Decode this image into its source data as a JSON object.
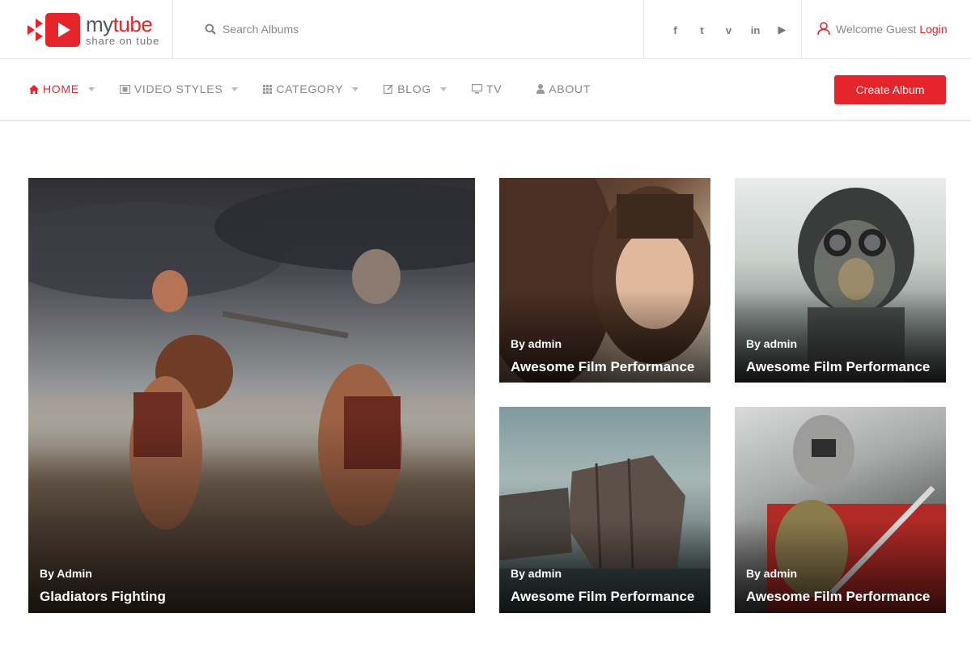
{
  "brand": {
    "name_part1": "my",
    "name_part2": "tube",
    "tagline": "share on tube",
    "accent": "#e5252b"
  },
  "search": {
    "placeholder": "Search Albums",
    "icon": "search-icon"
  },
  "social": [
    {
      "name": "facebook",
      "glyph": "f"
    },
    {
      "name": "twitter",
      "glyph": "t"
    },
    {
      "name": "vimeo",
      "glyph": "v"
    },
    {
      "name": "linkedin",
      "glyph": "in"
    },
    {
      "name": "youtube",
      "glyph": "▶"
    }
  ],
  "user": {
    "welcome": "Welcome Guest",
    "login": "Login",
    "icon": "user-icon"
  },
  "nav": {
    "items": [
      {
        "label": "HOME",
        "icon": "home-icon",
        "active": true,
        "dropdown": true
      },
      {
        "label": "VIDEO STYLES",
        "icon": "film-icon",
        "active": false,
        "dropdown": true
      },
      {
        "label": "CATEGORY",
        "icon": "grid-icon",
        "active": false,
        "dropdown": true
      },
      {
        "label": "BLOG",
        "icon": "edit-icon",
        "active": false,
        "dropdown": true
      },
      {
        "label": "TV",
        "icon": "monitor-icon",
        "active": false,
        "dropdown": false
      },
      {
        "label": "ABOUT",
        "icon": "person-icon",
        "active": false,
        "dropdown": false
      }
    ],
    "create_button": "Create Album"
  },
  "albums": {
    "featured": {
      "by": "By Admin",
      "title": "Gladiators Fighting"
    },
    "items": [
      {
        "by": "By admin",
        "title": "Awesome Film Performance"
      },
      {
        "by": "By admin",
        "title": "Awesome Film Performance"
      },
      {
        "by": "By admin",
        "title": "Awesome Film Performance"
      },
      {
        "by": "By admin",
        "title": "Awesome Film Performance"
      }
    ]
  }
}
